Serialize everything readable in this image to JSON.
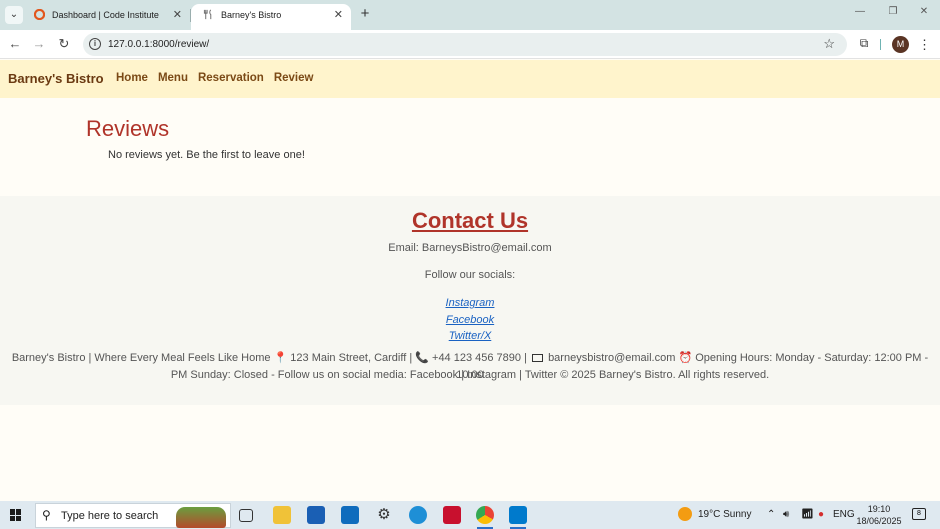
{
  "browser": {
    "tabs": [
      {
        "title": "Dashboard | Code Institute",
        "active": false
      },
      {
        "title": "Barney's Bistro",
        "active": true
      }
    ],
    "url": "127.0.0.1:8000/review/",
    "profile_initial": "M"
  },
  "site": {
    "brand": "Barney's Bistro",
    "nav": [
      "Home",
      "Menu",
      "Reservation",
      "Review"
    ]
  },
  "main": {
    "title": "Reviews",
    "empty_message": "No reviews yet. Be the first to leave one!"
  },
  "footer": {
    "contact_title": "Contact Us",
    "email_line": "Email: BarneysBistro@email.com",
    "follow_label": "Follow our socials:",
    "socials": [
      "Instagram",
      "Facebook",
      "Twitter/X"
    ],
    "tagline": "Barney's Bistro | Where Every Meal Feels Like Home",
    "address": "123 Main Street, Cardiff |",
    "phone": "+44 123 456 7890 |",
    "email": "barneysbistro@email.com",
    "hours_start": "Opening Hours: Monday - Saturday: 12:00 PM - 10:00",
    "hours_end_and_rest": "PM Sunday: Closed - Follow us on social media: Facebook | Instagram | Twitter © 2025 Barney's Bistro. All rights reserved."
  },
  "taskbar": {
    "search_placeholder": "Type here to search",
    "weather": "19°C  Sunny",
    "language": "ENG",
    "time": "19:10",
    "date": "18/06/2025",
    "notification_count": "8"
  },
  "colors": {
    "navbar_bg": "#fff4cc",
    "brand": "#6b3a12",
    "heading_red": "#b0342a",
    "link_blue": "#1a62c2"
  }
}
